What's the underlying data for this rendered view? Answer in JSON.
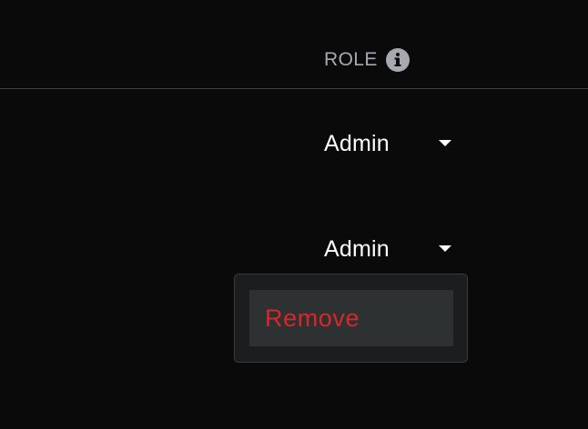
{
  "table": {
    "columns": {
      "role": {
        "label": "ROLE",
        "info_icon": "info-icon"
      }
    },
    "rows": [
      {
        "role": "Admin",
        "caret_icon": "caret-down-icon"
      },
      {
        "role": "Admin",
        "caret_icon": "caret-down-icon"
      }
    ]
  },
  "menu": {
    "items": [
      {
        "label": "Remove",
        "color": "#d6272a"
      }
    ]
  },
  "colors": {
    "background": "#0a0a0a",
    "header_text": "#a7a9b1",
    "menu_background": "#1c1d1e",
    "menu_item_hover": "#2e3132",
    "danger": "#d6272a"
  }
}
